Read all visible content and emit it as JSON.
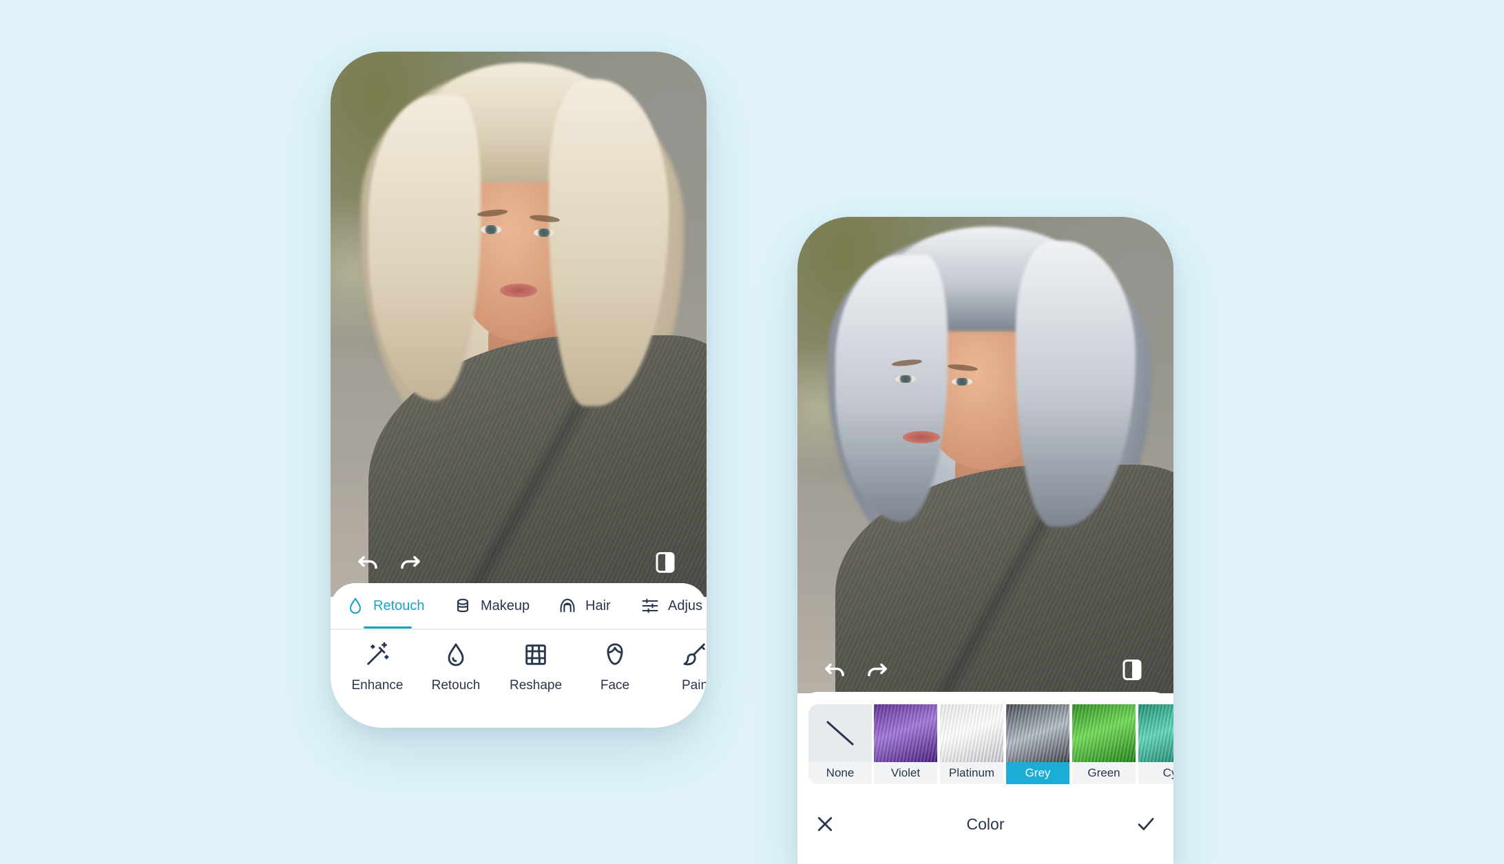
{
  "left_screen": {
    "tabs": [
      {
        "label": "Retouch",
        "icon": "drop-icon",
        "active": true
      },
      {
        "label": "Makeup",
        "icon": "makeup-icon",
        "active": false
      },
      {
        "label": "Hair",
        "icon": "hair-icon",
        "active": false
      },
      {
        "label": "Adjus",
        "icon": "sliders-icon",
        "active": false
      }
    ],
    "tools": [
      {
        "label": "Enhance",
        "icon": "magic-wand-icon"
      },
      {
        "label": "Retouch",
        "icon": "drop-icon"
      },
      {
        "label": "Reshape",
        "icon": "grid-icon"
      },
      {
        "label": "Face",
        "icon": "face-icon"
      },
      {
        "label": "Pain",
        "icon": "brush-icon"
      }
    ]
  },
  "right_screen": {
    "swatches": [
      {
        "label": "None",
        "selected": false
      },
      {
        "label": "Violet",
        "selected": false
      },
      {
        "label": "Platinum",
        "selected": false
      },
      {
        "label": "Grey",
        "selected": true
      },
      {
        "label": "Green",
        "selected": false
      },
      {
        "label": "Cy",
        "selected": false
      }
    ],
    "title": "Color"
  },
  "colors": {
    "background": "#dff3f9",
    "accent": "#17a3c6",
    "selected_swatch": "#1aaed6",
    "text": "#27364c"
  }
}
